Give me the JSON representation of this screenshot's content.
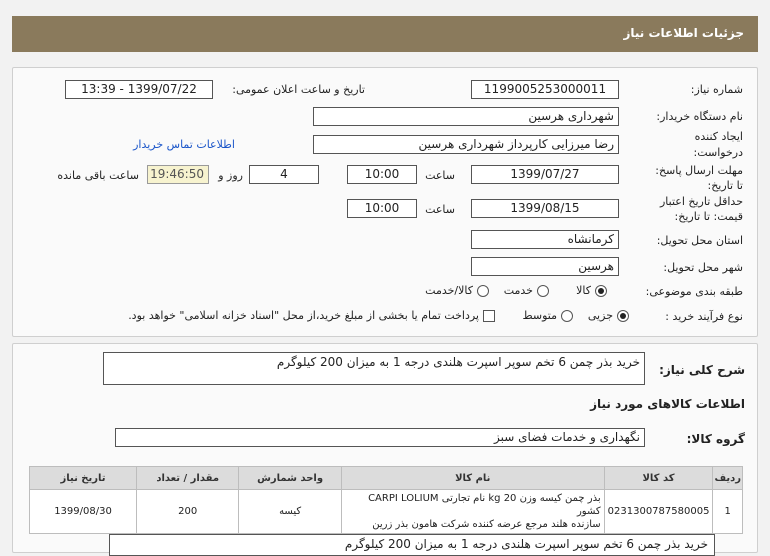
{
  "page": {
    "title": "جزئیات اطلاعات نیاز"
  },
  "form": {
    "need_number_label": "شماره نیاز:",
    "need_number": "1199005253000011",
    "announce_label": "تاریخ و ساعت اعلان عمومی:",
    "announce_value": "1399/07/22 - 13:39",
    "buyer_org_label": "نام دستگاه خریدار:",
    "buyer_org": "شهرداری هرسین",
    "creator_label_1": "ایجاد کننده",
    "creator_label_2": "درخواست:",
    "creator": "رضا میرزایی کارپرداز شهرداری هرسین",
    "contact_link": "اطلاعات تماس خریدار",
    "reply_deadline_label_1": "مهلت ارسال پاسخ:",
    "reply_deadline_label_2": "تا تاریخ:",
    "reply_date": "1399/07/27",
    "time_label": "ساعت",
    "reply_time": "10:00",
    "days_value": "4",
    "days_label": "روز و",
    "remaining_time": "19:46:50",
    "remaining_label": "ساعت باقی مانده",
    "validity_label_1": "حداقل تاریخ اعتبار",
    "validity_label_2": "قیمت: تا تاریخ:",
    "validity_date": "1399/08/15",
    "validity_time": "10:00",
    "province_label": "استان محل تحویل:",
    "province": "کرمانشاه",
    "city_label": "شهر محل تحویل:",
    "city": "هرسین",
    "category_label": "طبقه بندی موضوعی:",
    "category_options": [
      "کالا",
      "خدمت",
      "کالا/خدمت"
    ],
    "purchase_type_label": "نوع فرآیند خرید :",
    "purchase_options": [
      "جزیی",
      "متوسط"
    ],
    "payment_note": "پرداخت تمام یا بخشی از مبلغ خرید،از محل \"اسناد خزانه اسلامی\" خواهد بود."
  },
  "description": {
    "label": "شرح کلی نیاز:",
    "text": "خرید بذر چمن 6 تخم سوپر اسپرت هلندی درجه 1 به میزان 200 کیلوگرم"
  },
  "goods": {
    "section_title": "اطلاعات کالاهای مورد نیاز",
    "group_label": "گروه کالا:",
    "group_value": "نگهداری و خدمات فضای سبز",
    "columns": [
      "ردیف",
      "کد کالا",
      "نام کالا",
      "واحد شمارش",
      "مقدار / تعداد",
      "تاریخ نیاز"
    ],
    "rows": [
      {
        "row": "1",
        "code": "0231300787580005",
        "name_line1": "بذر چمن کیسه وزن 20 kg نام تجارتی CARPI LOLIUM کشور",
        "name_line2": "سازنده هلند مرجع عرضه کننده شرکت هامون بذر زرین",
        "unit": "کیسه",
        "qty": "200",
        "date": "1399/08/30"
      }
    ],
    "footer_text": "خرید بذر چمن 6 تخم سوپر اسپرت هلندی درجه 1 به میزان 200 کیلوگرم"
  },
  "colors": {
    "title_bar": "#8a7a5c",
    "link": "#1a55c9",
    "highlight": "#f7f3cf"
  }
}
